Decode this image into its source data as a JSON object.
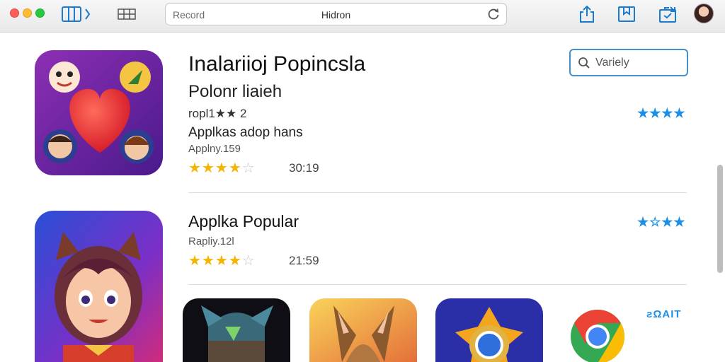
{
  "window": {
    "address_left": "Record",
    "address_center": "Hidron",
    "icons": [
      "sidebar-icon",
      "grid-icon",
      "reload-icon",
      "share-icon",
      "bookmark-icon",
      "tab-icon",
      "avatar"
    ]
  },
  "search": {
    "placeholder": "Variely",
    "icon": "search-icon"
  },
  "featured": {
    "title": "Inalariioj Popincsla",
    "subtitle": "Polonr liaieh",
    "rank": "ropl1★★ 2",
    "description": "Applkas adop hans",
    "meta": "Applny.159",
    "rating": 3.5,
    "count": "30:19",
    "side_stars": "★★★★"
  },
  "popular": {
    "title": "Applka Popular",
    "meta": "Rapliy.12l",
    "rating": 3.5,
    "count": "21:59",
    "side_stars": "★☆★★",
    "link": "ƨΩAIT"
  },
  "colors": {
    "accent": "#1e8fe6",
    "star": "#f4b400",
    "star_off": "#c8c8c8",
    "search_border": "#4a90c8"
  }
}
